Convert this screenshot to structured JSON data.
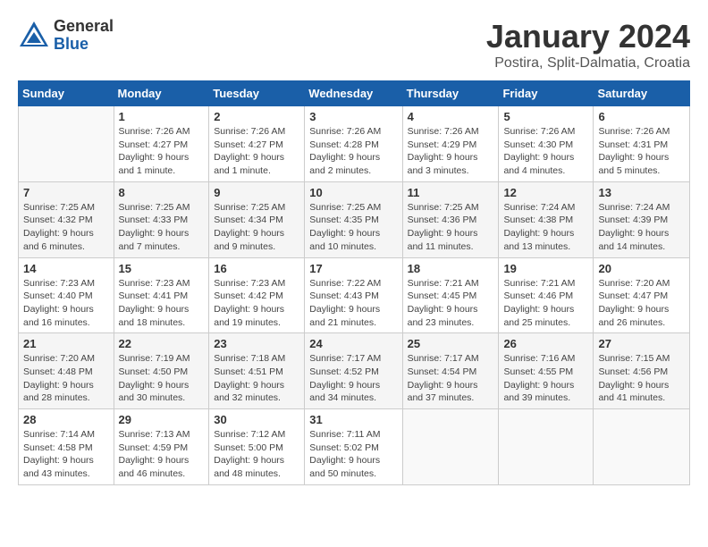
{
  "logo": {
    "general": "General",
    "blue": "Blue"
  },
  "header": {
    "month": "January 2024",
    "location": "Postira, Split-Dalmatia, Croatia"
  },
  "weekdays": [
    "Sunday",
    "Monday",
    "Tuesday",
    "Wednesday",
    "Thursday",
    "Friday",
    "Saturday"
  ],
  "weeks": [
    [
      {
        "day": "",
        "info": ""
      },
      {
        "day": "1",
        "info": "Sunrise: 7:26 AM\nSunset: 4:27 PM\nDaylight: 9 hours\nand 1 minute."
      },
      {
        "day": "2",
        "info": "Sunrise: 7:26 AM\nSunset: 4:27 PM\nDaylight: 9 hours\nand 1 minute."
      },
      {
        "day": "3",
        "info": "Sunrise: 7:26 AM\nSunset: 4:28 PM\nDaylight: 9 hours\nand 2 minutes."
      },
      {
        "day": "4",
        "info": "Sunrise: 7:26 AM\nSunset: 4:29 PM\nDaylight: 9 hours\nand 3 minutes."
      },
      {
        "day": "5",
        "info": "Sunrise: 7:26 AM\nSunset: 4:30 PM\nDaylight: 9 hours\nand 4 minutes."
      },
      {
        "day": "6",
        "info": "Sunrise: 7:26 AM\nSunset: 4:31 PM\nDaylight: 9 hours\nand 5 minutes."
      }
    ],
    [
      {
        "day": "7",
        "info": "Sunrise: 7:25 AM\nSunset: 4:32 PM\nDaylight: 9 hours\nand 6 minutes."
      },
      {
        "day": "8",
        "info": "Sunrise: 7:25 AM\nSunset: 4:33 PM\nDaylight: 9 hours\nand 7 minutes."
      },
      {
        "day": "9",
        "info": "Sunrise: 7:25 AM\nSunset: 4:34 PM\nDaylight: 9 hours\nand 9 minutes."
      },
      {
        "day": "10",
        "info": "Sunrise: 7:25 AM\nSunset: 4:35 PM\nDaylight: 9 hours\nand 10 minutes."
      },
      {
        "day": "11",
        "info": "Sunrise: 7:25 AM\nSunset: 4:36 PM\nDaylight: 9 hours\nand 11 minutes."
      },
      {
        "day": "12",
        "info": "Sunrise: 7:24 AM\nSunset: 4:38 PM\nDaylight: 9 hours\nand 13 minutes."
      },
      {
        "day": "13",
        "info": "Sunrise: 7:24 AM\nSunset: 4:39 PM\nDaylight: 9 hours\nand 14 minutes."
      }
    ],
    [
      {
        "day": "14",
        "info": "Sunrise: 7:23 AM\nSunset: 4:40 PM\nDaylight: 9 hours\nand 16 minutes."
      },
      {
        "day": "15",
        "info": "Sunrise: 7:23 AM\nSunset: 4:41 PM\nDaylight: 9 hours\nand 18 minutes."
      },
      {
        "day": "16",
        "info": "Sunrise: 7:23 AM\nSunset: 4:42 PM\nDaylight: 9 hours\nand 19 minutes."
      },
      {
        "day": "17",
        "info": "Sunrise: 7:22 AM\nSunset: 4:43 PM\nDaylight: 9 hours\nand 21 minutes."
      },
      {
        "day": "18",
        "info": "Sunrise: 7:21 AM\nSunset: 4:45 PM\nDaylight: 9 hours\nand 23 minutes."
      },
      {
        "day": "19",
        "info": "Sunrise: 7:21 AM\nSunset: 4:46 PM\nDaylight: 9 hours\nand 25 minutes."
      },
      {
        "day": "20",
        "info": "Sunrise: 7:20 AM\nSunset: 4:47 PM\nDaylight: 9 hours\nand 26 minutes."
      }
    ],
    [
      {
        "day": "21",
        "info": "Sunrise: 7:20 AM\nSunset: 4:48 PM\nDaylight: 9 hours\nand 28 minutes."
      },
      {
        "day": "22",
        "info": "Sunrise: 7:19 AM\nSunset: 4:50 PM\nDaylight: 9 hours\nand 30 minutes."
      },
      {
        "day": "23",
        "info": "Sunrise: 7:18 AM\nSunset: 4:51 PM\nDaylight: 9 hours\nand 32 minutes."
      },
      {
        "day": "24",
        "info": "Sunrise: 7:17 AM\nSunset: 4:52 PM\nDaylight: 9 hours\nand 34 minutes."
      },
      {
        "day": "25",
        "info": "Sunrise: 7:17 AM\nSunset: 4:54 PM\nDaylight: 9 hours\nand 37 minutes."
      },
      {
        "day": "26",
        "info": "Sunrise: 7:16 AM\nSunset: 4:55 PM\nDaylight: 9 hours\nand 39 minutes."
      },
      {
        "day": "27",
        "info": "Sunrise: 7:15 AM\nSunset: 4:56 PM\nDaylight: 9 hours\nand 41 minutes."
      }
    ],
    [
      {
        "day": "28",
        "info": "Sunrise: 7:14 AM\nSunset: 4:58 PM\nDaylight: 9 hours\nand 43 minutes."
      },
      {
        "day": "29",
        "info": "Sunrise: 7:13 AM\nSunset: 4:59 PM\nDaylight: 9 hours\nand 46 minutes."
      },
      {
        "day": "30",
        "info": "Sunrise: 7:12 AM\nSunset: 5:00 PM\nDaylight: 9 hours\nand 48 minutes."
      },
      {
        "day": "31",
        "info": "Sunrise: 7:11 AM\nSunset: 5:02 PM\nDaylight: 9 hours\nand 50 minutes."
      },
      {
        "day": "",
        "info": ""
      },
      {
        "day": "",
        "info": ""
      },
      {
        "day": "",
        "info": ""
      }
    ]
  ]
}
